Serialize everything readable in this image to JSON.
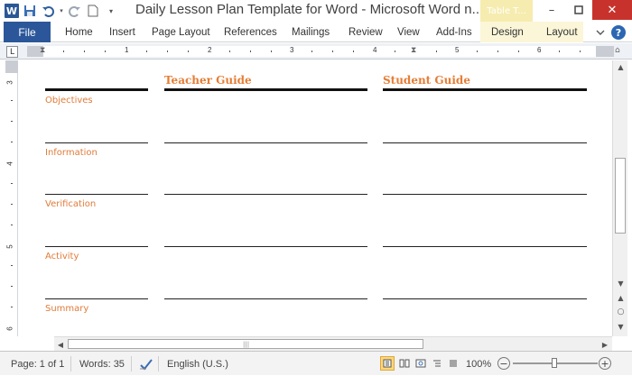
{
  "window": {
    "title": "Daily Lesson Plan Template for Word  -  Microsoft Word n...",
    "context_tab_group": "Table T..."
  },
  "ribbon": {
    "file_label": "File",
    "tabs": [
      "Home",
      "Insert",
      "Page Layout",
      "References",
      "Mailings",
      "Review",
      "View",
      "Add-Ins",
      "Design",
      "Layout"
    ]
  },
  "ruler": {
    "numbers": [
      "1",
      "2",
      "3",
      "4",
      "5",
      "6"
    ],
    "corner_symbol": "L",
    "vertical_numbers": [
      "3",
      "4",
      "5",
      "6"
    ]
  },
  "document": {
    "columns": [
      "Teacher Guide",
      "Student Guide"
    ],
    "rows": [
      "Objectives",
      "Information",
      "Verification",
      "Activity",
      "Summary"
    ]
  },
  "status": {
    "page": "Page: 1 of 1",
    "words": "Words: 35",
    "language": "English (U.S.)",
    "zoom": "100%",
    "zoom_level_percent": 100
  },
  "colors": {
    "accent_orange": "#e57d36",
    "file_tab_blue": "#2b579a",
    "context_tab_yellow": "#f6ecaf"
  }
}
